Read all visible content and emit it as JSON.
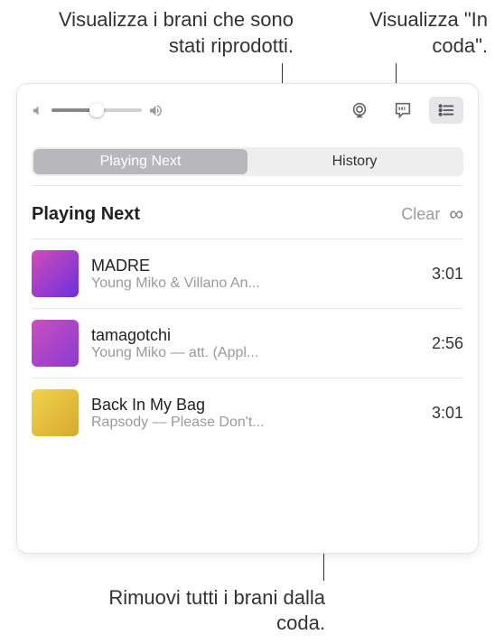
{
  "callouts": {
    "history": "Visualizza i brani che sono stati riprodotti.",
    "queue": "Visualizza \"In coda\".",
    "clear": "Rimuovi tutti i brani dalla coda."
  },
  "segmented": {
    "playing_next": "Playing Next",
    "history": "History"
  },
  "section": {
    "title": "Playing Next",
    "clear_label": "Clear"
  },
  "tracks": [
    {
      "title": "MADRE",
      "subtitle": "Young Miko & Villano An...",
      "duration": "3:01"
    },
    {
      "title": "tamagotchi",
      "subtitle": "Young Miko — att. (Appl...",
      "duration": "2:56"
    },
    {
      "title": "Back In My Bag",
      "subtitle": "Rapsody — Please Don't...",
      "duration": "3:01"
    }
  ]
}
